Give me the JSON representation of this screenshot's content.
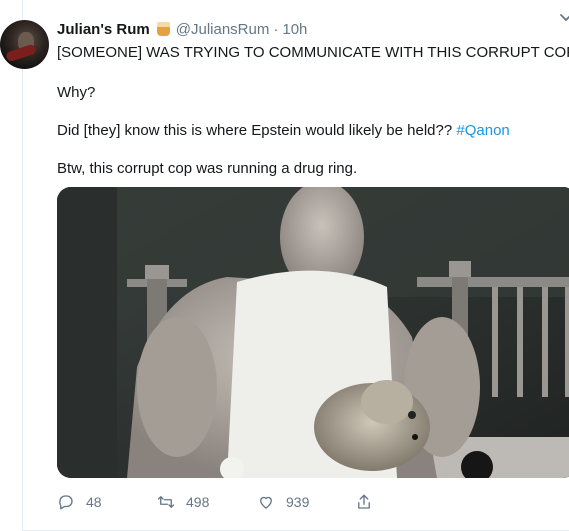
{
  "tweet": {
    "display_name": "Julian's Rum",
    "handle": "@JuliansRum",
    "separator": "·",
    "time": "10h",
    "lines": [
      "[SOMEONE] WAS TRYING TO COMMUNICATE WITH THIS CORRUPT COP.",
      "Why?",
      "Did [they] know this is where Epstein would likely be held??",
      "Btw, this corrupt cop was running a drug ring."
    ],
    "hashtag": "#Qanon"
  },
  "actions": {
    "reply_count": "48",
    "retweet_count": "498",
    "like_count": "939",
    "icons": [
      "reply-icon",
      "retweet-icon",
      "like-icon",
      "share-icon"
    ]
  },
  "colors": {
    "text": "#14171a",
    "secondary": "#657786",
    "link": "#1b95e0",
    "border": "#e6ecf0"
  }
}
